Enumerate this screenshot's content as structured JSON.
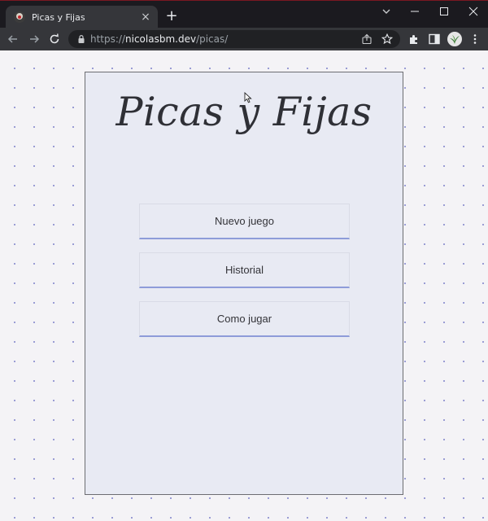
{
  "browser": {
    "tab": {
      "title": "Picas y Fijas",
      "close_glyph": "×",
      "favicon": "picas-favicon"
    },
    "new_tab_glyph": "+",
    "address": {
      "scheme": "https://",
      "host": "nicolasbm.dev",
      "path": "/picas/"
    }
  },
  "page": {
    "title": "Picas y Fijas",
    "buttons": [
      {
        "label": "Nuevo juego"
      },
      {
        "label": "Historial"
      },
      {
        "label": "Como jugar"
      }
    ]
  },
  "colors": {
    "card_background": "#e8eaf3",
    "button_underline": "#8e9cd9",
    "dot_pattern": "#8c8fcf",
    "titlebar_accent": "#7a1722"
  }
}
